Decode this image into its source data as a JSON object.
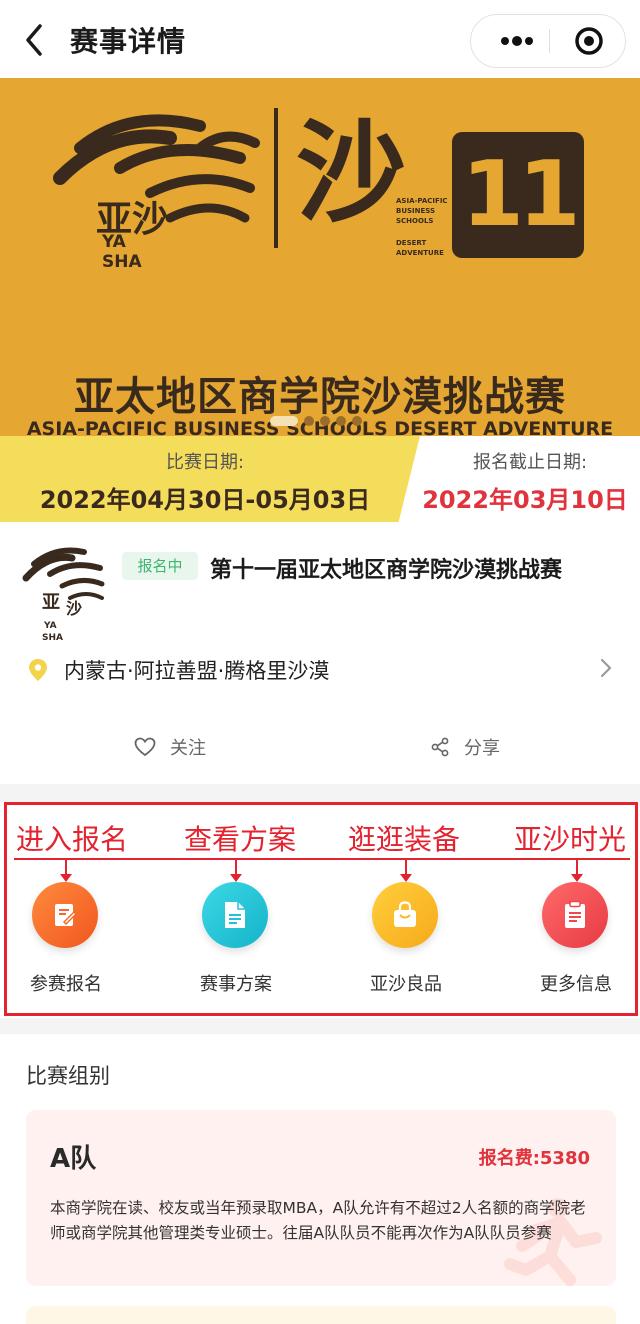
{
  "nav": {
    "title": "赛事详情"
  },
  "banner": {
    "logo_text": "YA SHA",
    "logo_cn": "亚沙",
    "sha_char": "沙",
    "tagline_en": "ASIA-PACIFIC BUSINESS SCHOOLS",
    "tagline_en2": "DESERT ADVENTURE",
    "edition_number": "11",
    "title_cn": "亚太地区商学院沙漠挑战赛",
    "title_en": "ASIA-PACIFIC BUSINESS SCHOOLS DESERT ADVENTURE",
    "carousel_count": 5,
    "carousel_active": 1,
    "colors": {
      "background": "#e5a731",
      "ink": "#3a2a1d"
    }
  },
  "dates": {
    "match_label": "比赛日期:",
    "match_value": "2022年04月30日-05月03日",
    "deadline_label": "报名截止日期:",
    "deadline_value": "2022年03月10日"
  },
  "event": {
    "status_badge": "报名中",
    "name": "第十一届亚太地区商学院沙漠挑战赛",
    "location": "内蒙古·阿拉善盟·腾格里沙漠",
    "follow_label": "关注",
    "share_label": "分享"
  },
  "actions": {
    "annotations": [
      "进入报名",
      "查看方案",
      "逛逛装备",
      "亚沙时光"
    ],
    "items": [
      {
        "label": "参赛报名",
        "icon": "edit-icon",
        "color": "#f26a2c"
      },
      {
        "label": "赛事方案",
        "icon": "document-icon",
        "color": "#22c2d6"
      },
      {
        "label": "亚沙良品",
        "icon": "shopping-bag-icon",
        "color": "#f9b824"
      },
      {
        "label": "更多信息",
        "icon": "clipboard-icon",
        "color": "#f0474e"
      }
    ],
    "annotation_color": "#e3232f"
  },
  "groups": {
    "heading": "比赛组别",
    "teams": [
      {
        "name": "A队",
        "fee": "报名费:5380",
        "description": "本商学院在读、校友或当年预录取MBA，A队允许有不超过2人名额的商学院老师或商学院其他管理类专业硕士。往届A队队员不能再次作为A队队员参赛"
      }
    ]
  }
}
